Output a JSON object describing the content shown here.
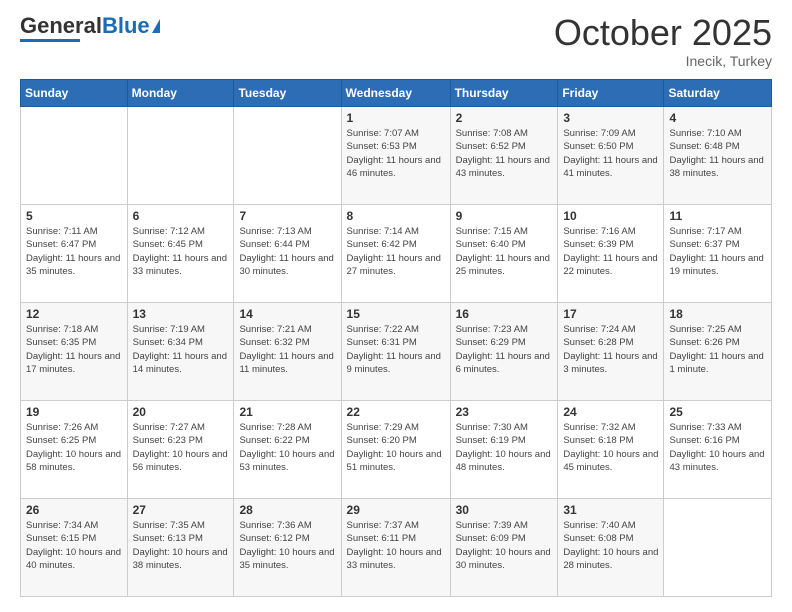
{
  "logo": {
    "general": "General",
    "blue": "Blue"
  },
  "title": "October 2025",
  "location": "Inecik, Turkey",
  "headers": [
    "Sunday",
    "Monday",
    "Tuesday",
    "Wednesday",
    "Thursday",
    "Friday",
    "Saturday"
  ],
  "weeks": [
    [
      {
        "day": "",
        "info": ""
      },
      {
        "day": "",
        "info": ""
      },
      {
        "day": "",
        "info": ""
      },
      {
        "day": "1",
        "info": "Sunrise: 7:07 AM\nSunset: 6:53 PM\nDaylight: 11 hours and 46 minutes."
      },
      {
        "day": "2",
        "info": "Sunrise: 7:08 AM\nSunset: 6:52 PM\nDaylight: 11 hours and 43 minutes."
      },
      {
        "day": "3",
        "info": "Sunrise: 7:09 AM\nSunset: 6:50 PM\nDaylight: 11 hours and 41 minutes."
      },
      {
        "day": "4",
        "info": "Sunrise: 7:10 AM\nSunset: 6:48 PM\nDaylight: 11 hours and 38 minutes."
      }
    ],
    [
      {
        "day": "5",
        "info": "Sunrise: 7:11 AM\nSunset: 6:47 PM\nDaylight: 11 hours and 35 minutes."
      },
      {
        "day": "6",
        "info": "Sunrise: 7:12 AM\nSunset: 6:45 PM\nDaylight: 11 hours and 33 minutes."
      },
      {
        "day": "7",
        "info": "Sunrise: 7:13 AM\nSunset: 6:44 PM\nDaylight: 11 hours and 30 minutes."
      },
      {
        "day": "8",
        "info": "Sunrise: 7:14 AM\nSunset: 6:42 PM\nDaylight: 11 hours and 27 minutes."
      },
      {
        "day": "9",
        "info": "Sunrise: 7:15 AM\nSunset: 6:40 PM\nDaylight: 11 hours and 25 minutes."
      },
      {
        "day": "10",
        "info": "Sunrise: 7:16 AM\nSunset: 6:39 PM\nDaylight: 11 hours and 22 minutes."
      },
      {
        "day": "11",
        "info": "Sunrise: 7:17 AM\nSunset: 6:37 PM\nDaylight: 11 hours and 19 minutes."
      }
    ],
    [
      {
        "day": "12",
        "info": "Sunrise: 7:18 AM\nSunset: 6:35 PM\nDaylight: 11 hours and 17 minutes."
      },
      {
        "day": "13",
        "info": "Sunrise: 7:19 AM\nSunset: 6:34 PM\nDaylight: 11 hours and 14 minutes."
      },
      {
        "day": "14",
        "info": "Sunrise: 7:21 AM\nSunset: 6:32 PM\nDaylight: 11 hours and 11 minutes."
      },
      {
        "day": "15",
        "info": "Sunrise: 7:22 AM\nSunset: 6:31 PM\nDaylight: 11 hours and 9 minutes."
      },
      {
        "day": "16",
        "info": "Sunrise: 7:23 AM\nSunset: 6:29 PM\nDaylight: 11 hours and 6 minutes."
      },
      {
        "day": "17",
        "info": "Sunrise: 7:24 AM\nSunset: 6:28 PM\nDaylight: 11 hours and 3 minutes."
      },
      {
        "day": "18",
        "info": "Sunrise: 7:25 AM\nSunset: 6:26 PM\nDaylight: 11 hours and 1 minute."
      }
    ],
    [
      {
        "day": "19",
        "info": "Sunrise: 7:26 AM\nSunset: 6:25 PM\nDaylight: 10 hours and 58 minutes."
      },
      {
        "day": "20",
        "info": "Sunrise: 7:27 AM\nSunset: 6:23 PM\nDaylight: 10 hours and 56 minutes."
      },
      {
        "day": "21",
        "info": "Sunrise: 7:28 AM\nSunset: 6:22 PM\nDaylight: 10 hours and 53 minutes."
      },
      {
        "day": "22",
        "info": "Sunrise: 7:29 AM\nSunset: 6:20 PM\nDaylight: 10 hours and 51 minutes."
      },
      {
        "day": "23",
        "info": "Sunrise: 7:30 AM\nSunset: 6:19 PM\nDaylight: 10 hours and 48 minutes."
      },
      {
        "day": "24",
        "info": "Sunrise: 7:32 AM\nSunset: 6:18 PM\nDaylight: 10 hours and 45 minutes."
      },
      {
        "day": "25",
        "info": "Sunrise: 7:33 AM\nSunset: 6:16 PM\nDaylight: 10 hours and 43 minutes."
      }
    ],
    [
      {
        "day": "26",
        "info": "Sunrise: 7:34 AM\nSunset: 6:15 PM\nDaylight: 10 hours and 40 minutes."
      },
      {
        "day": "27",
        "info": "Sunrise: 7:35 AM\nSunset: 6:13 PM\nDaylight: 10 hours and 38 minutes."
      },
      {
        "day": "28",
        "info": "Sunrise: 7:36 AM\nSunset: 6:12 PM\nDaylight: 10 hours and 35 minutes."
      },
      {
        "day": "29",
        "info": "Sunrise: 7:37 AM\nSunset: 6:11 PM\nDaylight: 10 hours and 33 minutes."
      },
      {
        "day": "30",
        "info": "Sunrise: 7:39 AM\nSunset: 6:09 PM\nDaylight: 10 hours and 30 minutes."
      },
      {
        "day": "31",
        "info": "Sunrise: 7:40 AM\nSunset: 6:08 PM\nDaylight: 10 hours and 28 minutes."
      },
      {
        "day": "",
        "info": ""
      }
    ]
  ]
}
